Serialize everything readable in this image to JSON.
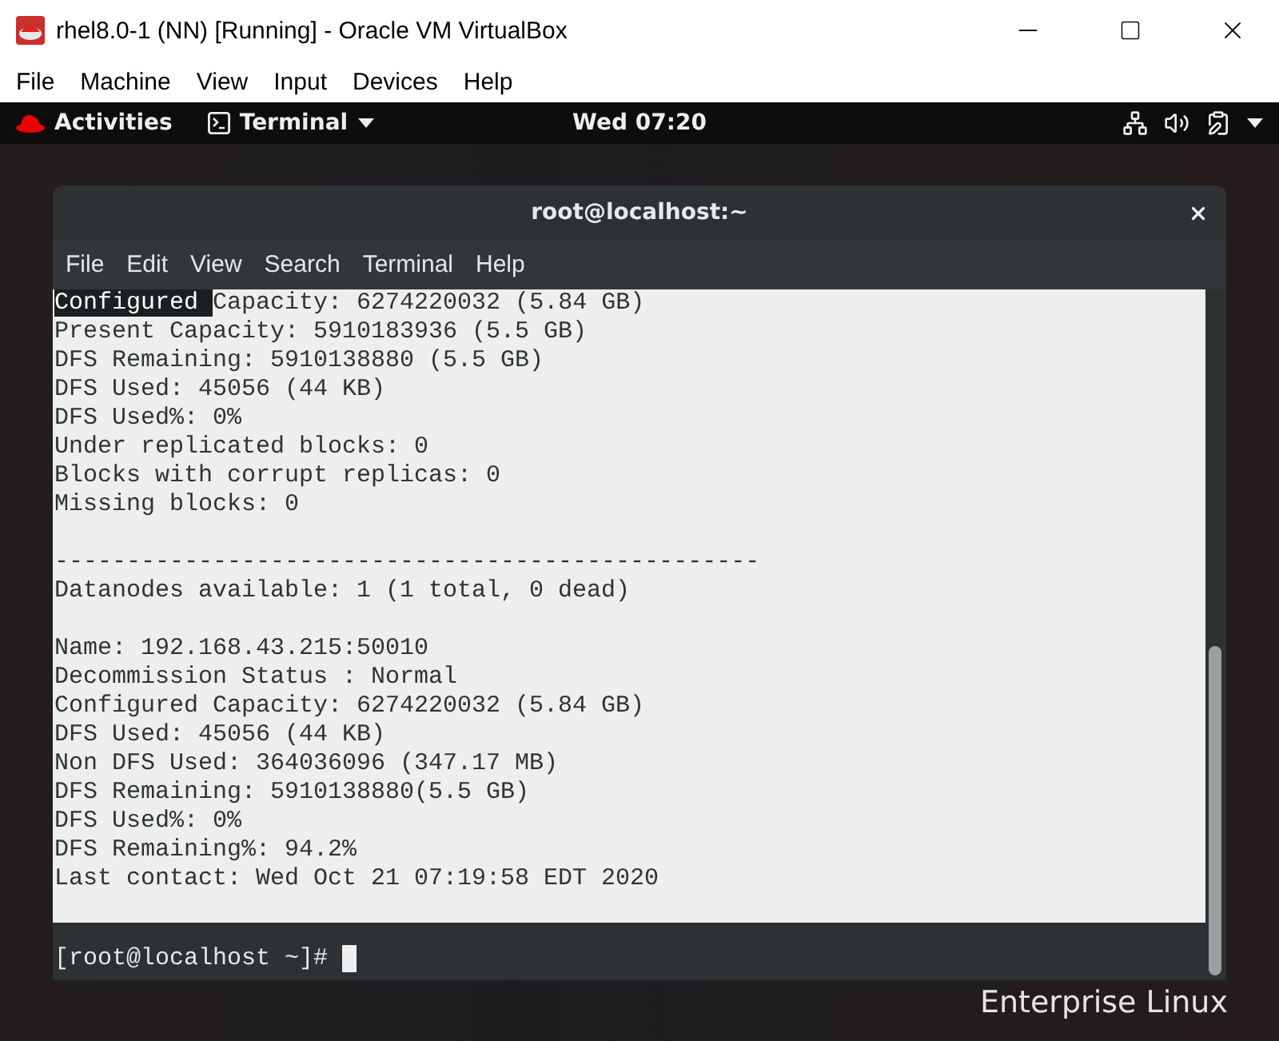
{
  "host_window": {
    "title": "rhel8.0-1 (NN) [Running] - Oracle VM VirtualBox",
    "menu": [
      "File",
      "Machine",
      "View",
      "Input",
      "Devices",
      "Help"
    ]
  },
  "top_bar": {
    "activities": "Activities",
    "app": "Terminal",
    "clock": "Wed 07:20"
  },
  "terminal": {
    "title": "root@localhost:~",
    "menu": [
      "File",
      "Edit",
      "View",
      "Search",
      "Terminal",
      "Help"
    ],
    "blocks": [
      {
        "lines": [
          {
            "selected": "Configured ",
            "text": "Capacity: 6274220032 (5.84 GB)"
          },
          {
            "text": "Present Capacity: 5910183936 (5.5 GB)"
          },
          {
            "text": "DFS Remaining: 5910138880 (5.5 GB)"
          },
          {
            "text": "DFS Used: 45056 (44 KB)"
          },
          {
            "text": "DFS Used%: 0%"
          },
          {
            "text": "Under replicated blocks: 0"
          },
          {
            "text": "Blocks with corrupt replicas: 0"
          },
          {
            "text": "Missing blocks: 0"
          }
        ]
      },
      {
        "lines": [
          {
            "text": "-------------------------------------------------"
          },
          {
            "text": "Datanodes available: 1 (1 total, 0 dead)"
          }
        ]
      },
      {
        "lines": [
          {
            "text": "Name: 192.168.43.215:50010"
          },
          {
            "text": "Decommission Status : Normal"
          },
          {
            "text": "Configured Capacity: 6274220032 (5.84 GB)"
          },
          {
            "text": "DFS Used: 45056 (44 KB)"
          },
          {
            "text": "Non DFS Used: 364036096 (347.17 MB)"
          },
          {
            "text": "DFS Remaining: 5910138880(5.5 GB)"
          },
          {
            "text": "DFS Used%: 0%"
          },
          {
            "text": "DFS Remaining%: 94.2%"
          },
          {
            "text": "Last contact: Wed Oct 21 07:19:58 EDT 2020"
          }
        ]
      }
    ],
    "prompt": "[root@localhost ~]#"
  },
  "desktop": {
    "brand": "Enterprise Linux"
  }
}
